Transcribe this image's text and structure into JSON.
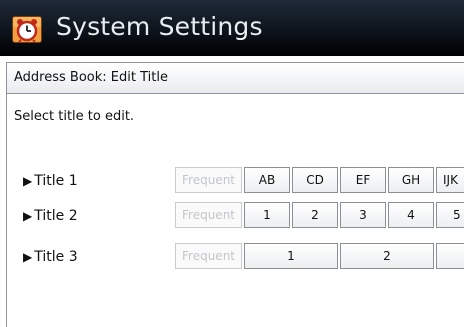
{
  "app": {
    "title": "System Settings",
    "icon": "alarm-clock-icon",
    "accent": "#e36a17"
  },
  "header": {
    "title": "Address Book: Edit Title"
  },
  "instruction": "Select title to edit.",
  "rows": [
    {
      "label": "Title 1",
      "keys": [
        "Frequent",
        "AB",
        "CD",
        "EF",
        "GH",
        "IJK"
      ]
    },
    {
      "label": "Title 2",
      "keys": [
        "Frequent",
        "1",
        "2",
        "3",
        "4",
        "5"
      ]
    },
    {
      "label": "Title 3",
      "keys": [
        "Frequent",
        "1",
        "2",
        ""
      ]
    }
  ]
}
